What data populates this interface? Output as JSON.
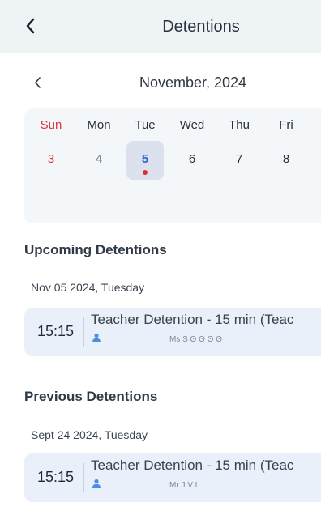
{
  "header": {
    "title": "Detentions",
    "back_icon": "back-chevron-icon"
  },
  "calendar": {
    "month_label": "November, 2024",
    "prev_icon": "month-prev-icon",
    "day_names": [
      "Sun",
      "Mon",
      "Tue",
      "Wed",
      "Thu",
      "Fri"
    ],
    "days": [
      "3",
      "4",
      "5",
      "6",
      "7",
      "8"
    ],
    "selected_day": "5"
  },
  "sections": {
    "upcoming_title": "Upcoming Detentions",
    "previous_title": "Previous Detentions"
  },
  "upcoming": {
    "date": "Nov 05 2024, Tuesday",
    "time": "15:15",
    "title": "Teacher Detention - 15 min (Teac",
    "teacher": "Ms S ʘ ʘ ʘ ʘ"
  },
  "previous": {
    "date": "Sept 24 2024, Tuesday",
    "time": "15:15",
    "title": "Teacher Detention - 15 min (Teac",
    "teacher": "Mr J V I"
  },
  "colors": {
    "header_bg": "#eef3f6",
    "sunday_red": "#d9363e",
    "selected_blue": "#2e66c8",
    "card_bg": "#e9f0fa"
  }
}
